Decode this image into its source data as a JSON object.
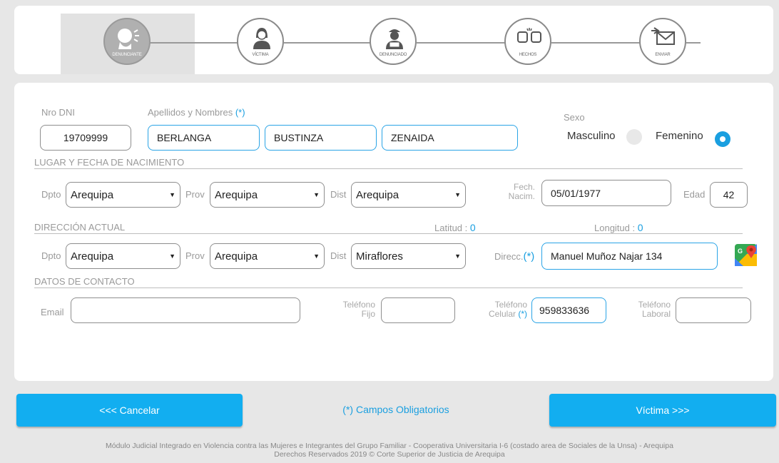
{
  "wizard": {
    "steps": [
      {
        "label": "DENUNCIANTE",
        "active": true
      },
      {
        "label": "VÍCTIMA",
        "active": false
      },
      {
        "label": "DENUNCIADO",
        "active": false
      },
      {
        "label": "HECHOS",
        "active": false
      },
      {
        "label": "ENVIAR",
        "active": false
      }
    ]
  },
  "identity": {
    "dni_label": "Nro DNI",
    "dni": "19709999",
    "names_label": "Apellidos y Nombres",
    "required_mark": "(*)",
    "apellido_paterno": "BERLANGA",
    "apellido_materno": "BUSTINZA",
    "nombres": "ZENAIDA",
    "sexo_label": "Sexo",
    "masculino": "Masculino",
    "femenino": "Femenino",
    "selected_sex": "Femenino"
  },
  "birth": {
    "section_title": "LUGAR Y FECHA DE NACIMIENTO",
    "dpto_label": "Dpto",
    "dpto": "Arequipa",
    "prov_label": "Prov",
    "prov": "Arequipa",
    "dist_label": "Dist",
    "dist": "Arequipa",
    "fecha_label_1": "Fech.",
    "fecha_label_2": "Nacim.",
    "fecha": "05/01/1977",
    "edad_label": "Edad",
    "edad": "42"
  },
  "address": {
    "section_title": "DIRECCIÓN ACTUAL",
    "latitud_label": "Latitud :",
    "latitud": "0",
    "longitud_label": "Longitud :",
    "longitud": "0",
    "dpto_label": "Dpto",
    "dpto": "Arequipa",
    "prov_label": "Prov",
    "prov": "Arequipa",
    "dist_label": "Dist",
    "dist": "Miraflores",
    "direcc_label": "Direcc.",
    "required_mark": "(*)",
    "direccion": "Manuel Muñoz Najar 134",
    "map_icon": "google-maps-icon"
  },
  "contact": {
    "section_title": "DATOS DE CONTACTO",
    "email_label": "Email",
    "email": "",
    "fijo_label_1": "Teléfono",
    "fijo_label_2": "Fijo",
    "fijo": "",
    "celular_label_1": "Teléfono",
    "celular_label_2": "Celular",
    "required_mark": "(*)",
    "celular": "959833636",
    "laboral_label_1": "Teléfono",
    "laboral_label_2": "Laboral",
    "laboral": ""
  },
  "actions": {
    "cancel": "<<< Cancelar",
    "required_note": "(*) Campos Obligatorios",
    "next": "Víctima >>>"
  },
  "footer": {
    "line1": "Módulo Judicial Integrado en Violencia contra las Mujeres e Integrantes del Grupo Familiar - Cooperativa Universitaria I-6 (costado area de Sociales de la Unsa) - Arequipa",
    "line2": "Derechos Reservados 2019 © Corte Superior de Justicia de Arequipa"
  },
  "colors": {
    "accent": "#12aef0",
    "input_border_active": "#2aa4e6"
  }
}
